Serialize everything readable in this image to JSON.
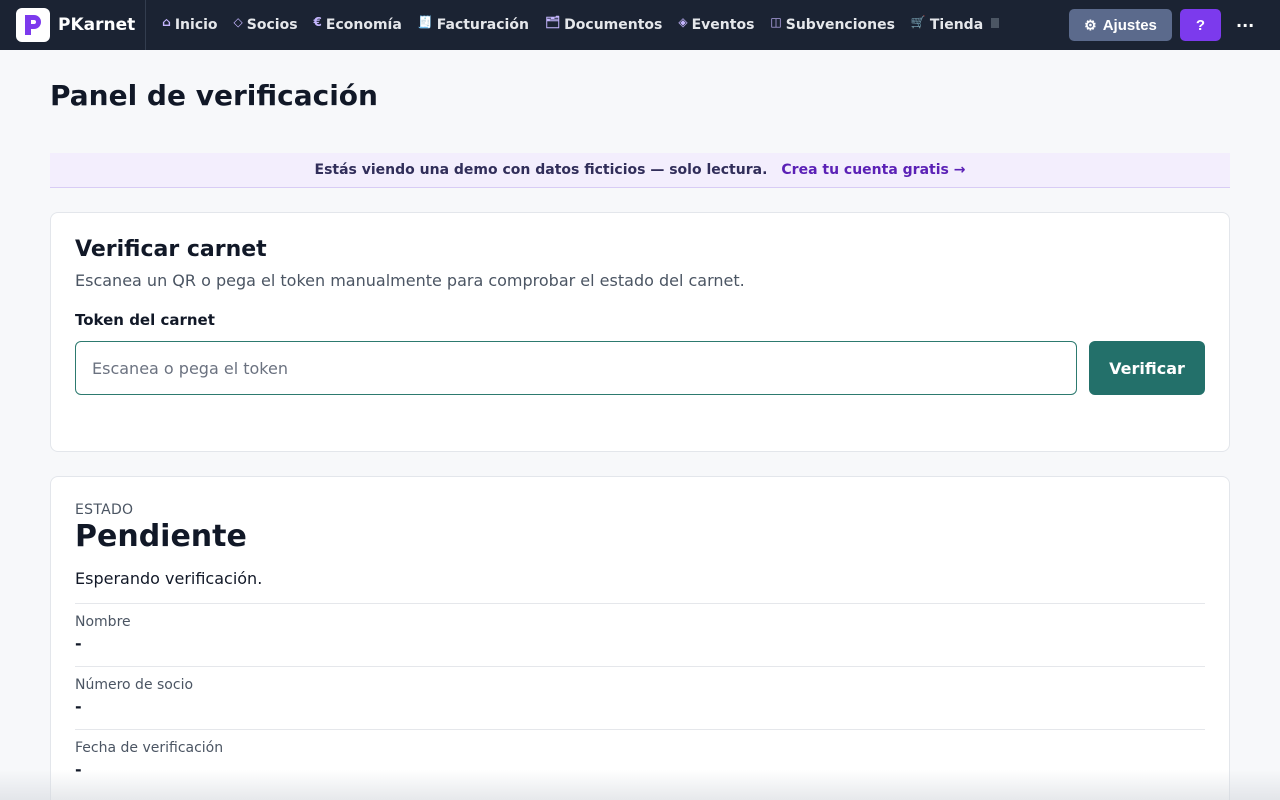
{
  "app": {
    "name": "PKarnet",
    "logo_letter": "P",
    "brand_color": "#7c3aed"
  },
  "nav": {
    "items": [
      {
        "label": "Inicio",
        "icon": "home-icon",
        "glyph": "⌂"
      },
      {
        "label": "Socios",
        "icon": "diamond-icon",
        "glyph": "◇"
      },
      {
        "label": "Economía",
        "icon": "euro-icon",
        "glyph": "€"
      },
      {
        "label": "Facturación",
        "icon": "receipt-icon",
        "glyph": "🧾"
      },
      {
        "label": "Documentos",
        "icon": "folder-icon",
        "glyph": "🗂"
      },
      {
        "label": "Eventos",
        "icon": "event-diamond-icon",
        "glyph": "◈"
      },
      {
        "label": "Subvenciones",
        "icon": "columns-icon",
        "glyph": "◫"
      },
      {
        "label": "Tienda",
        "icon": "cart-icon",
        "glyph": "🛒"
      }
    ],
    "settings_label": "Ajustes",
    "settings_glyph": "⚙",
    "help_label": "?",
    "more_label": "..."
  },
  "page": {
    "title": "Panel de verificación"
  },
  "banner": {
    "text": "Estás viendo una demo con datos ficticios — solo lectura.",
    "link": "Crea tu cuenta gratis →"
  },
  "verify": {
    "title": "Verificar carnet",
    "subtitle": "Escanea un QR o pega el token manualmente para comprobar el estado del carnet.",
    "token_label": "Token del carnet",
    "token_value": "",
    "token_placeholder": "Escanea o pega el token",
    "button_label": "Verificar"
  },
  "status": {
    "eyebrow": "ESTADO",
    "value": "Pendiente",
    "description": "Esperando verificación.",
    "fields": [
      {
        "label": "Nombre",
        "value": "-"
      },
      {
        "label": "Número de socio",
        "value": "-"
      },
      {
        "label": "Fecha de verificación",
        "value": "-"
      }
    ]
  },
  "colors": {
    "topbar": "#1b2333",
    "accent": "#7c3aed",
    "primary_button": "#23706a",
    "settings_button": "#5b6a8c"
  }
}
